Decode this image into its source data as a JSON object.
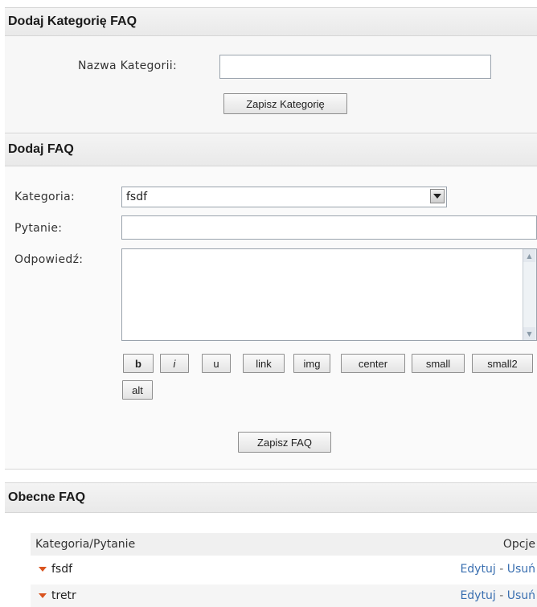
{
  "add_category": {
    "title": "Dodaj Kategorię FAQ",
    "name_label": "Nazwa Kategorii:",
    "name_value": "",
    "save_button": "Zapisz Kategorię"
  },
  "add_faq": {
    "title": "Dodaj FAQ",
    "category_label": "Kategoria:",
    "category_selected": "fsdf",
    "question_label": "Pytanie:",
    "question_value": "",
    "answer_label": "Odpowiedź:",
    "answer_value": "",
    "toolbar": {
      "b": "b",
      "i": "i",
      "u": "u",
      "link": "link",
      "img": "img",
      "center": "center",
      "small": "small",
      "small2": "small2",
      "alt": "alt"
    },
    "save_button": "Zapisz FAQ"
  },
  "current_faq": {
    "title": "Obecne FAQ",
    "col_question": "Kategoria/Pytanie",
    "col_options": "Opcje",
    "rows": [
      {
        "name": "fsdf",
        "edit": "Edytuj",
        "sep": "-",
        "delete": "Usuń"
      },
      {
        "name": "tretr",
        "edit": "Edytuj",
        "sep": "-",
        "delete": "Usuń"
      }
    ]
  },
  "colors": {
    "link": "#3a6fb0",
    "bullet": "#d9531e",
    "panel_header": "#eaeaea"
  }
}
